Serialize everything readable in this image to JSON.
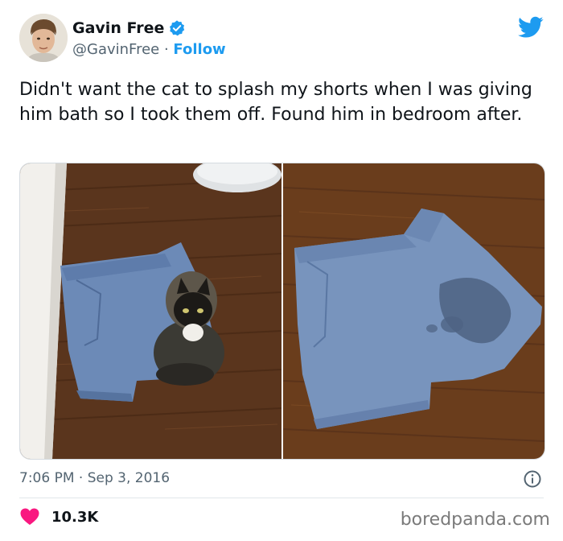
{
  "user": {
    "name": "Gavin Free",
    "handle": "@GavinFree",
    "separator": " · ",
    "follow_label": "Follow"
  },
  "tweet": {
    "text": "Didn't want the cat to splash my shorts when I was giving him bath so I took them off. Found him in bedroom after."
  },
  "meta": {
    "time": "7:06 PM",
    "separator": " · ",
    "date": "Sep 3, 2016"
  },
  "engagement": {
    "likes": "10.3K"
  },
  "watermark": "boredpanda.com",
  "colors": {
    "accent": "#1d9bf0",
    "heart": "#f91880",
    "text": "#0f1419",
    "muted": "#536471"
  },
  "icons": {
    "verified": "verified-badge-icon",
    "brand": "twitter-bird-icon",
    "info": "info-icon",
    "like": "heart-icon"
  }
}
